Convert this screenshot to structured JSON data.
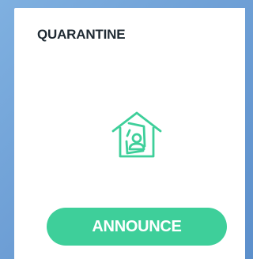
{
  "card": {
    "title": "QUARANTINE",
    "icon": "home-quarantine-icon",
    "button_label": "ANNOUNCE"
  },
  "colors": {
    "accent": "#3ecf9a",
    "card_background": "#ffffff",
    "title_text": "#1f2a33",
    "page_background": "#6fa0d6"
  }
}
